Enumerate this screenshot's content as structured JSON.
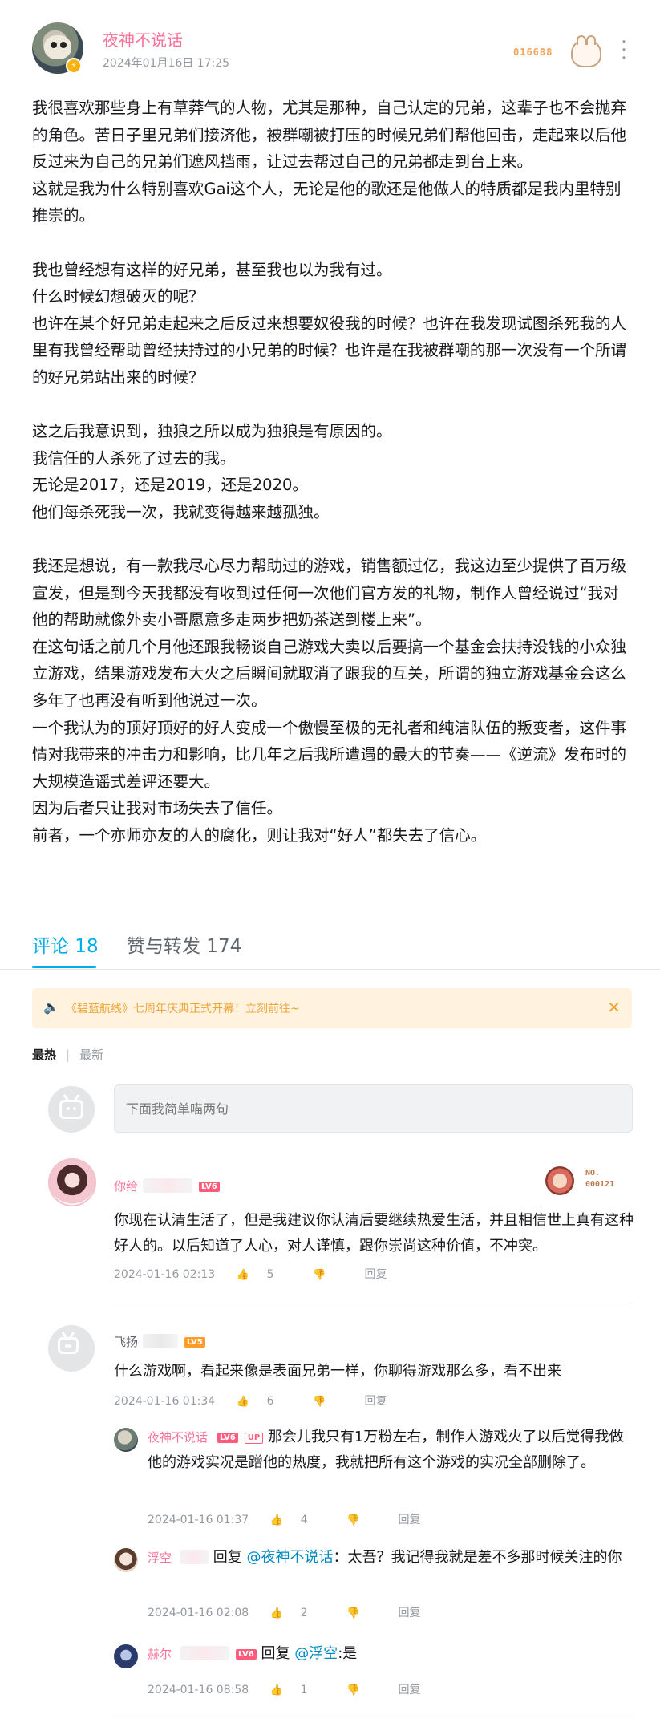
{
  "post": {
    "author": "夜神不说话",
    "time": "2024年01月16日 17:25",
    "fan_number": "016688",
    "paragraphs": [
      "我很喜欢那些身上有草莽气的人物，尤其是那种，自己认定的兄弟，这辈子也不会抛弃的角色。苦日子里兄弟们接济他，被群嘲被打压的时候兄弟们帮他回击，走起来以后他反过来为自己的兄弟们遮风挡雨，让过去帮过自己的兄弟都走到台上来。",
      "这就是我为什么特别喜欢Gai这个人，无论是他的歌还是他做人的特质都是我内里特别推崇的。",
      "",
      "我也曾经想有这样的好兄弟，甚至我也以为我有过。",
      "什么时候幻想破灭的呢？",
      "也许在某个好兄弟走起来之后反过来想要奴役我的时候？也许在我发现试图杀死我的人里有我曾经帮助曾经扶持过的小兄弟的时候？也许是在我被群嘲的那一次没有一个所谓的好兄弟站出来的时候？",
      "",
      "这之后我意识到，独狼之所以成为独狼是有原因的。",
      "我信任的人杀死了过去的我。",
      "无论是2017，还是2019，还是2020。",
      "他们每杀死我一次，我就变得越来越孤独。",
      "",
      "我还是想说，有一款我尽心尽力帮助过的游戏，销售额过亿，我这边至少提供了百万级宣发，但是到今天我都没有收到过任何一次他们官方发的礼物，制作人曾经说过“我对他的帮助就像外卖小哥愿意多走两步把奶茶送到楼上来”。",
      "在这句话之前几个月他还跟我畅谈自己游戏大卖以后要搞一个基金会扶持没钱的小众独立游戏，结果游戏发布大火之后瞬间就取消了跟我的互关，所谓的独立游戏基金会这么多年了也再没有听到他说过一次。",
      "一个我认为的顶好顶好的好人变成一个傲慢至极的无礼者和纯洁队伍的叛变者，这件事情对我带来的冲击力和影响，比几年之后我所遭遇的最大的节奏——《逆流》发布时的大规模造谣式差评还要大。",
      "因为后者只让我对市场失去了信任。",
      "前者，一个亦师亦友的人的腐化，则让我对“好人”都失去了信心。"
    ]
  },
  "tabs": {
    "comments": "评论 18",
    "likes": "赞与转发 174"
  },
  "notice": {
    "text": "《碧蓝航线》七周年庆典正式开幕！立刻前往~"
  },
  "sort": {
    "hot": "最热",
    "new": "最新"
  },
  "input": {
    "placeholder": "下面我简单喵两句"
  },
  "comments": [
    {
      "name": "你给",
      "level": "LV6",
      "badge_no": "NO.",
      "badge_num": "000121",
      "text": "你现在认清生活了，但是我建议你认清后要继续热爱生活，并且相信世上真有这种好人的。以后知道了人心，对人谨慎，跟你崇尚这种价值，不冲突。",
      "time": "2024-01-16 02:13",
      "likes": "5",
      "reply_label": "回复"
    },
    {
      "name": "飞扬",
      "level": "LV5",
      "text": "什么游戏啊，看起来像是表面兄弟一样，你聊得游戏那么多，看不出来",
      "time": "2024-01-16 01:34",
      "likes": "6",
      "reply_label": "回复",
      "replies": [
        {
          "name": "夜神不说话",
          "level": "LV6",
          "up": "UP",
          "text": "那会儿我只有1万粉左右，制作人游戏火了以后觉得我做他的游戏实况是蹭他的热度，我就把所有这个游戏的实况全部删除了。",
          "time": "2024-01-16 01:37",
          "likes": "4",
          "reply_label": "回复"
        },
        {
          "name": "浮空",
          "reply_word": "回复",
          "mention": "@夜神不说话",
          "text": "：太吾？我记得我就是差不多那时候关注的你",
          "time": "2024-01-16 02:08",
          "likes": "2",
          "reply_label": "回复"
        },
        {
          "name": "赫尔",
          "level": "LV6",
          "reply_word": "回复",
          "mention": "@浮空",
          "text": ":是",
          "time": "2024-01-16 08:58",
          "likes": "1",
          "reply_label": "回复"
        }
      ]
    }
  ]
}
